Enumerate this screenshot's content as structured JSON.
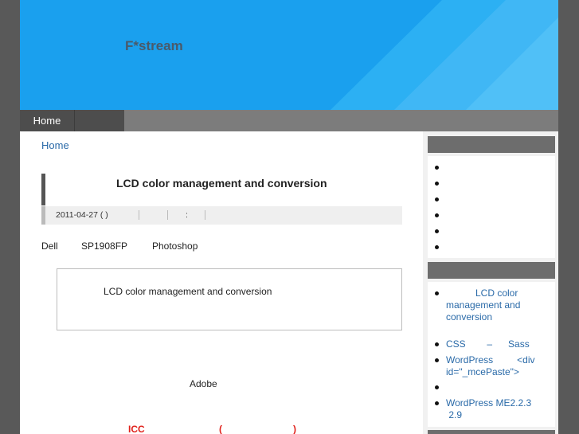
{
  "header": {
    "site_title": "F*stream",
    "colors": {
      "banner": "#1aa0ee",
      "banner_stripe": "#48baf5"
    }
  },
  "nav": {
    "items": [
      {
        "label": "Home"
      },
      {
        "label": ""
      }
    ]
  },
  "breadcrumb": {
    "home": "Home"
  },
  "post": {
    "title": "LCD color management and conversion",
    "meta": {
      "date": "2011-04-27 ( )",
      "colon": ":"
    },
    "intro": [
      "Dell",
      "SP1908FP",
      "Photoshop"
    ],
    "related_box": {
      "link": "LCD color management and conversion"
    },
    "body_text": "Adobe",
    "icc_line": [
      "ICC",
      "(",
      ")"
    ]
  },
  "sidebar": {
    "widget1": {
      "items": [
        "",
        "",
        "",
        "",
        "",
        ""
      ]
    },
    "widget2": {
      "items": [
        {
          "lines": [
            "LCD color",
            "management and",
            "conversion"
          ]
        },
        {
          "lines": [
            "CSS        –      Sass"
          ]
        },
        {
          "lines": [
            "WordPress         <div",
            "id=\"_mcePaste\">"
          ]
        },
        {
          "lines": [
            ""
          ]
        },
        {
          "lines": [
            "WordPress ME2.2.3",
            " 2.9"
          ]
        }
      ]
    }
  }
}
